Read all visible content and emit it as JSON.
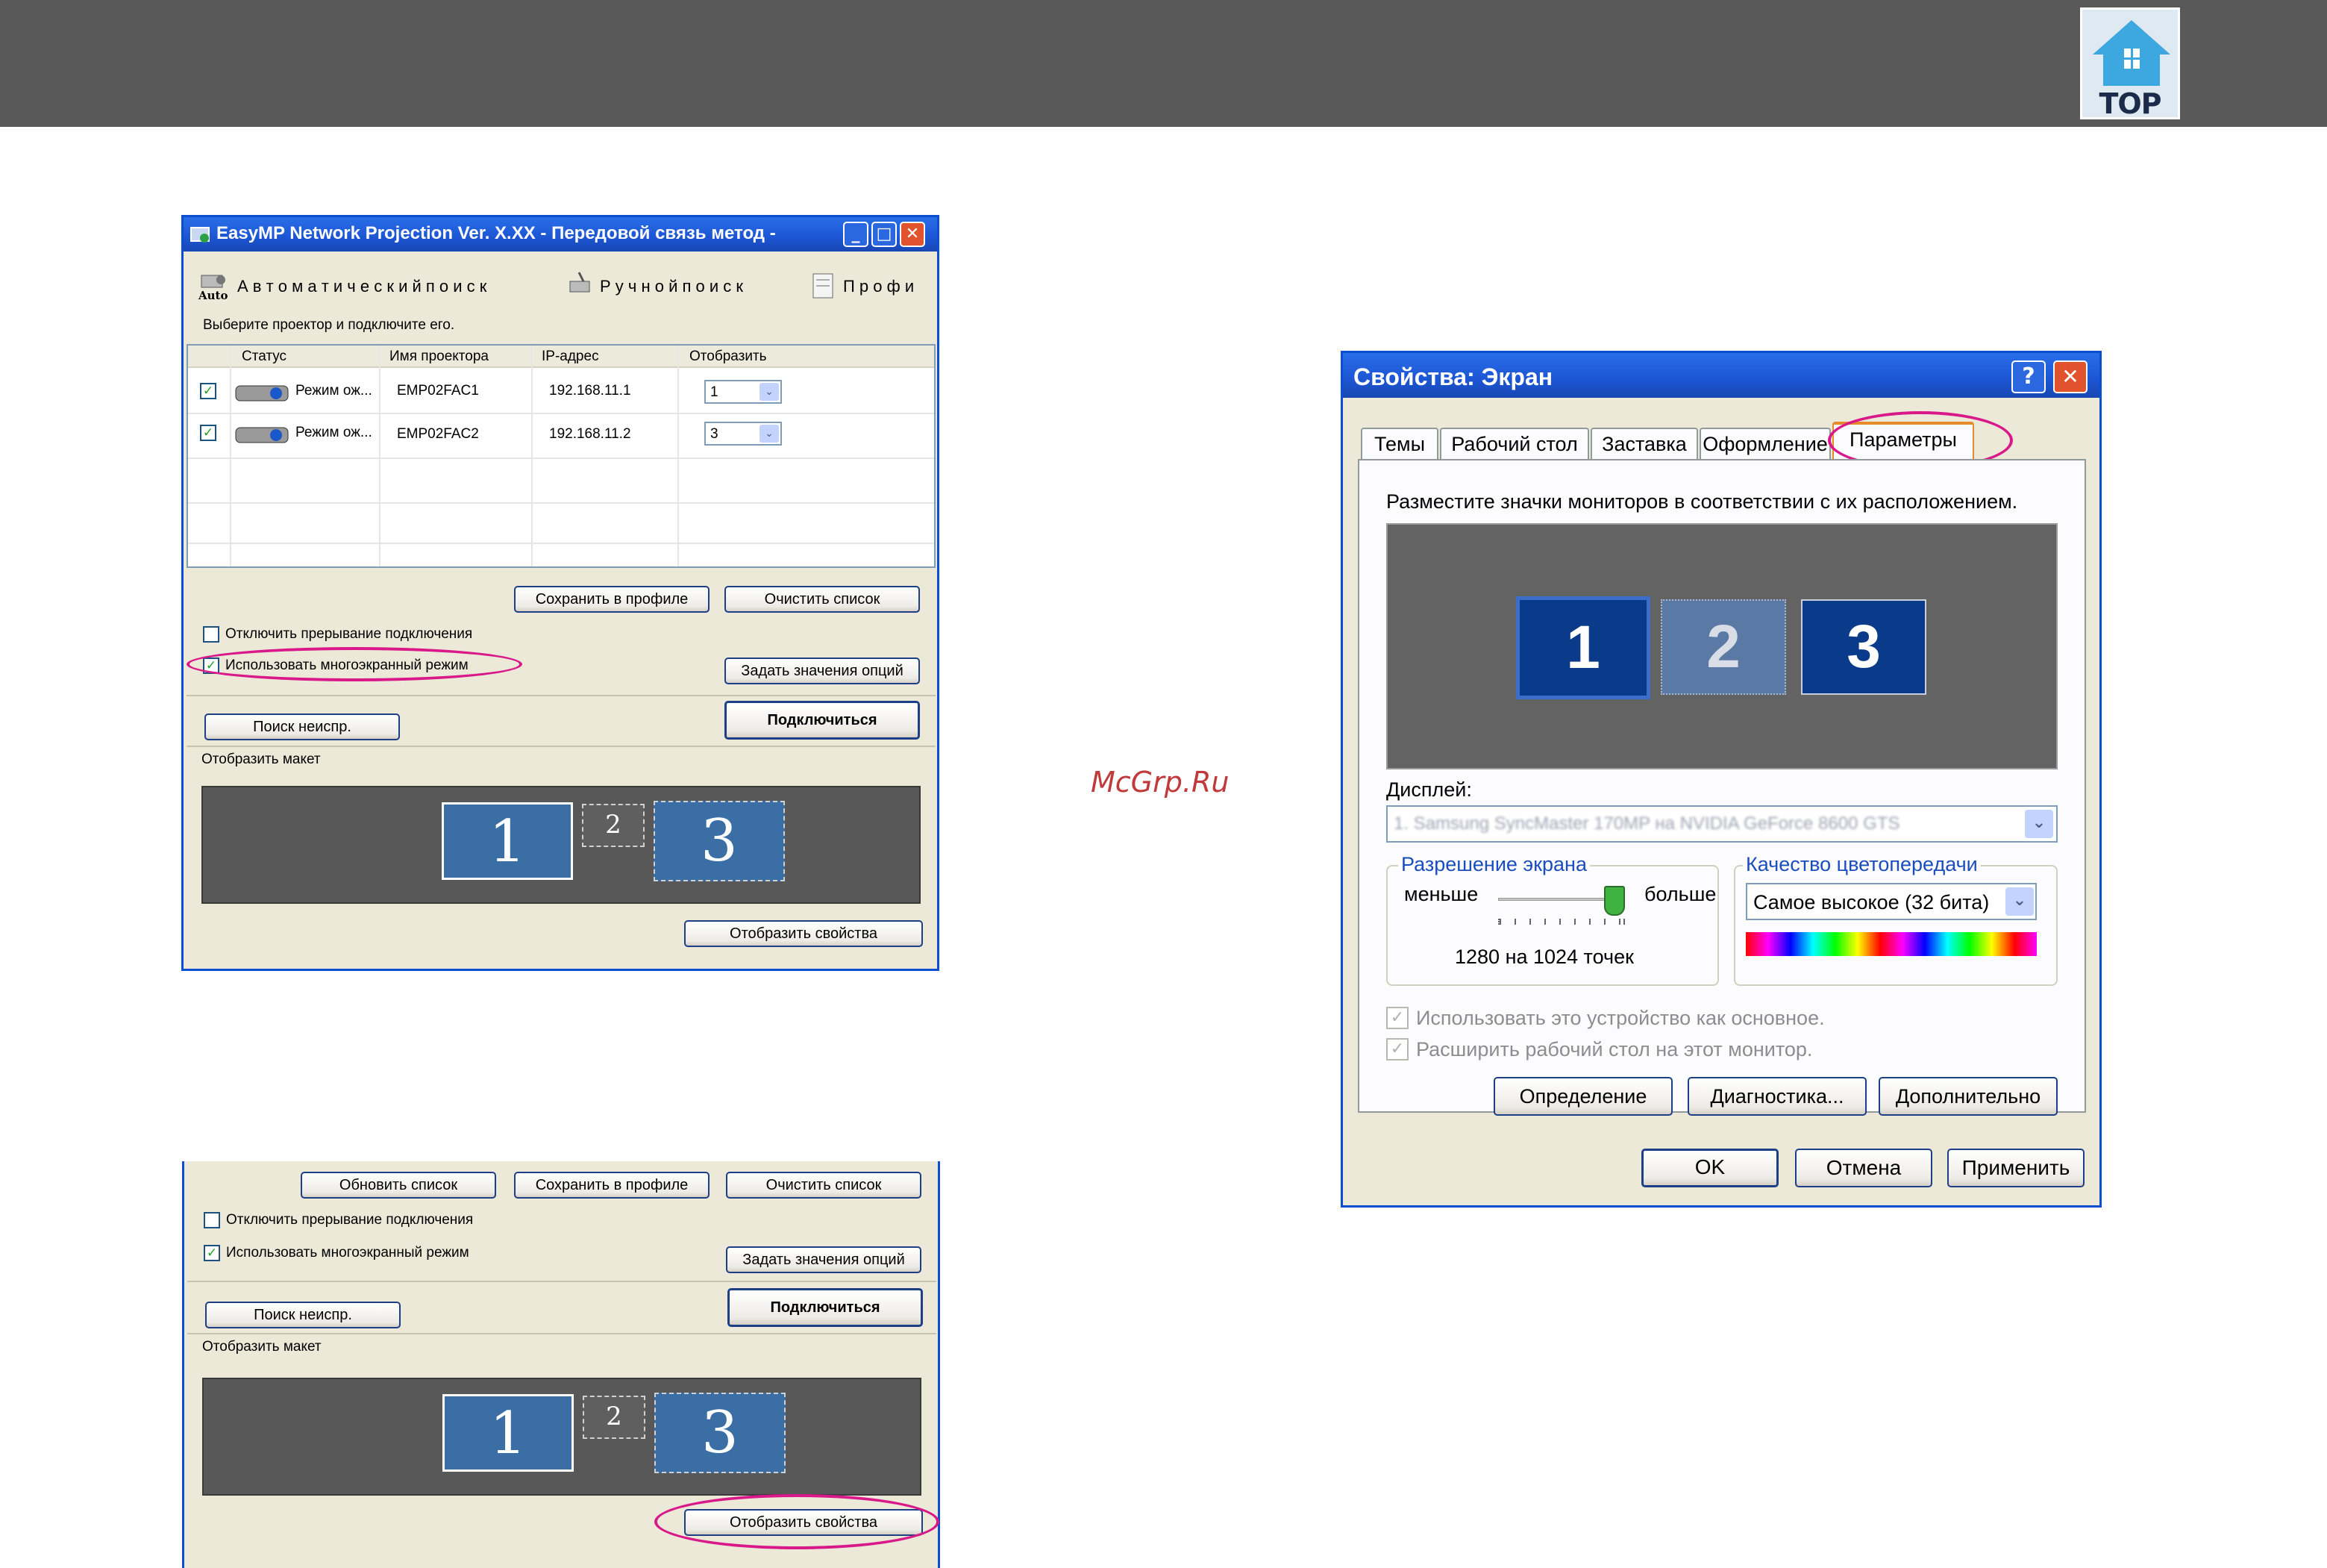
{
  "header": {
    "logo_text": "TOP"
  },
  "watermark": "McGrp.Ru",
  "window1": {
    "title": "EasyMP Network Projection Ver. X.XX - Передовой связь метод -",
    "toolbar": {
      "auto_label": "Auto",
      "auto_search": "А в т о м а т и ч е с к и й   п о и с к",
      "manual_search": "Р у ч н о й   п о и с к",
      "profile": "П р о ф и"
    },
    "prompt": "Выберите проектор и подключите его.",
    "columns": [
      "Статус",
      "Имя проектора",
      "IP-адрес",
      "Отобразить"
    ],
    "rows": [
      {
        "status": "Режим ож...",
        "name": "EMP02FAC1",
        "ip": "192.168.11.1",
        "display": "1"
      },
      {
        "status": "Режим ож...",
        "name": "EMP02FAC2",
        "ip": "192.168.11.2",
        "display": "3"
      }
    ],
    "save_profile": "Сохранить в профиле",
    "clear_list": "Очистить список",
    "disable_interrupt": "Отключить прерывание подключения",
    "use_multiscreen": "Использовать многоэкранный режим",
    "set_options": "Задать значения опций",
    "search_fault": "Поиск неиспр.",
    "connect": "Подключиться",
    "layout_label": "Отобразить макет",
    "layout_screens": [
      "1",
      "2",
      "3"
    ],
    "show_props": "Отобразить свойства"
  },
  "window2": {
    "refresh_list": "Обновить список",
    "save_profile": "Сохранить в профиле",
    "clear_list": "Очистить список",
    "disable_interrupt": "Отключить прерывание подключения",
    "use_multiscreen": "Использовать многоэкранный режим",
    "set_options": "Задать значения опций",
    "search_fault": "Поиск неиспр.",
    "connect": "Подключиться",
    "layout_label": "Отобразить макет",
    "layout_screens": [
      "1",
      "2",
      "3"
    ],
    "show_props": "Отобразить свойства"
  },
  "dialog": {
    "title": "Свойства: Экран",
    "help": "?",
    "tabs": [
      "Темы",
      "Рабочий стол",
      "Заставка",
      "Оформление",
      "Параметры"
    ],
    "arrange_text": "Разместите значки мониторов в соответствии с их расположением.",
    "monitors": [
      "1",
      "2",
      "3"
    ],
    "display_label": "Дисплей:",
    "display_value": "1. Samsung SyncMaster 170MP на NVIDIA GeForce 8600 GTS",
    "resolution_group": "Разрешение экрана",
    "less": "меньше",
    "more": "больше",
    "resolution_value": "1280 на 1024 точек",
    "resolution_slider_fraction": 1.0,
    "color_group": "Качество цветопередачи",
    "color_value": "Самое высокое (32 бита)",
    "primary_device": "Использовать это устройство как основное.",
    "extend_desktop": "Расширить рабочий стол на этот монитор.",
    "identify": "Определение",
    "diagnostics": "Диагностика...",
    "advanced": "Дополнительно",
    "ok": "OK",
    "cancel": "Отмена",
    "apply": "Применить"
  }
}
